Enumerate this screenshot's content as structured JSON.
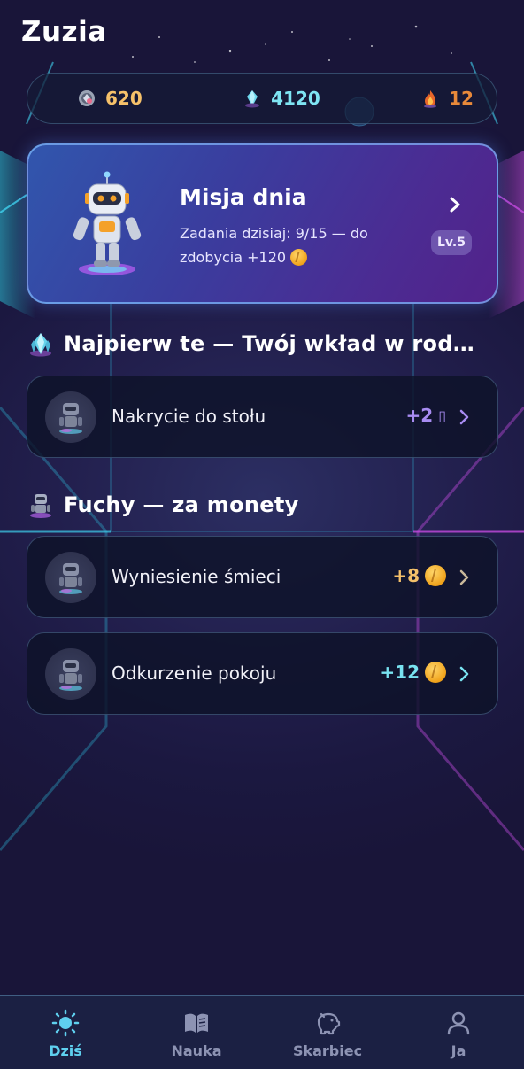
{
  "header": {
    "title": "Zuzia"
  },
  "currencies": [
    {
      "icon": "gear-gem-icon",
      "value": "620",
      "color": "#f6c16a"
    },
    {
      "icon": "crystal-icon",
      "value": "4120",
      "color": "#7ee4f3"
    },
    {
      "icon": "flame-icon",
      "value": "12",
      "color": "#e8893a"
    }
  ],
  "mission": {
    "title": "Misja dnia",
    "subtitle_line1": "Zadania dzisiaj: 9/15 — do",
    "subtitle_line2": "zdobycia +120",
    "level": "Lv.5"
  },
  "sections": [
    {
      "icon": "crystal-icon",
      "title": "Najpierw te — Twój wkład w rod…",
      "tasks": [
        {
          "label": "Nakrycie do stołu",
          "reward": "+2",
          "reward_icon": "missing-glyph",
          "color": "#a88cf2"
        }
      ]
    },
    {
      "icon": "robot-icon",
      "title": "Fuchy — za monety",
      "tasks": [
        {
          "label": "Wyniesienie śmieci",
          "reward": "+8",
          "reward_icon": "coin-icon",
          "color": "#f5c06a"
        },
        {
          "label": "Odkurzenie pokoju",
          "reward": "+12",
          "reward_icon": "coin-icon",
          "color": "#79e3f1"
        }
      ]
    }
  ],
  "nav": {
    "items": [
      {
        "label": "Dziś",
        "icon": "sun-icon",
        "active": true
      },
      {
        "label": "Nauka",
        "icon": "book-icon",
        "active": false
      },
      {
        "label": "Skarbiec",
        "icon": "piggy-bank-icon",
        "active": false
      },
      {
        "label": "Ja",
        "icon": "user-icon",
        "active": false
      }
    ]
  }
}
